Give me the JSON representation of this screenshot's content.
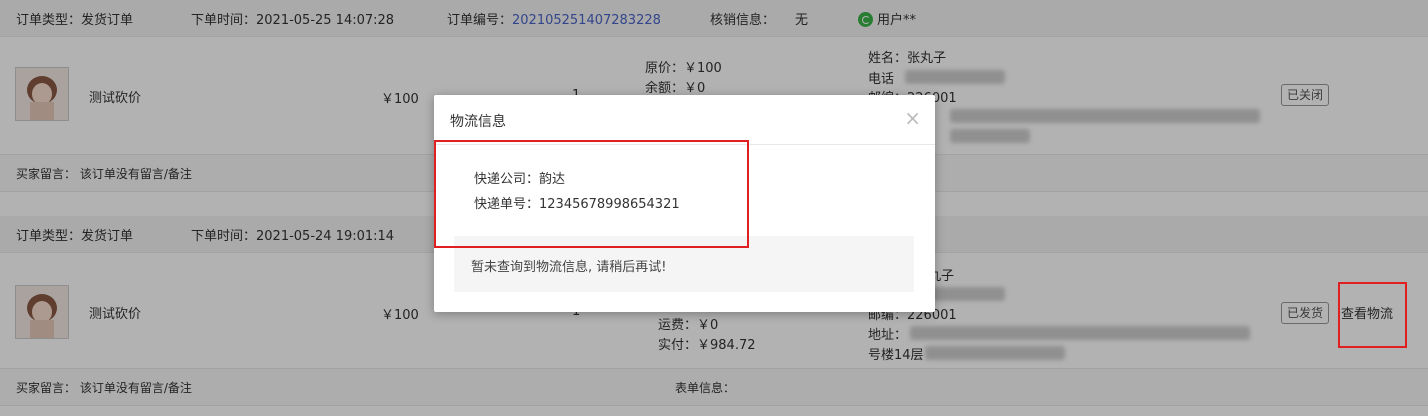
{
  "orders": [
    {
      "header": {
        "type_label": "订单类型：发货订单",
        "time_label": "下单时间：2021-05-25 14:07:28",
        "number_prefix": "订单编号：",
        "number_value": "202105251407283228",
        "verify_label": "核销信息：",
        "verify_value": "无",
        "user_label": "用户**"
      },
      "product_name": "测试砍价",
      "price": "￥100",
      "qty": "1",
      "amounts": [
        "原价：￥100",
        "余额：￥0"
      ],
      "address": {
        "name": "姓名：张丸子",
        "phone": "电话",
        "postcode": "邮编：226001"
      },
      "status_tag": "已关闭",
      "remark": "买家留言：  该订单没有留言/备注"
    },
    {
      "header": {
        "type_label": "订单类型：发货订单",
        "time_label": "下单时间：2021-05-24 19:01:14"
      },
      "product_name": "测试砍价",
      "price": "￥100",
      "qty": "1",
      "amounts": [
        "运费：￥0",
        "实付：￥984.72"
      ],
      "address": {
        "name_tail": "丸子",
        "postcode": "邮编：226001",
        "addr": "地址：",
        "building": "号楼14层"
      },
      "status_tag": "已发货",
      "action_link": "查看物流",
      "remark": "买家留言：  该订单没有留言/备注",
      "form_info": "表单信息："
    }
  ],
  "modal": {
    "title": "物流信息",
    "close_glyph": "×",
    "company": "快递公司：韵达",
    "tracking": "快递单号：12345678998654321",
    "notice": "暂未查询到物流信息, 请稍后再试!"
  },
  "colors": {
    "link": "#4a63c8",
    "highlight": "#e02020"
  }
}
